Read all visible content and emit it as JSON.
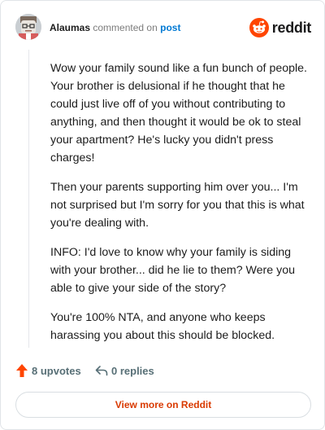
{
  "header": {
    "username": "Alaumas",
    "verb": "commented on",
    "target": "post",
    "brand": "reddit",
    "brand_color": "#ff4500"
  },
  "comment": {
    "paragraphs": [
      "Wow your family sound like a fun bunch of people. Your brother is delusional if he thought that he could just live off of you without contributing to anything, and then thought it would be ok to steal your apartment? He's lucky you didn't press charges!",
      "Then your parents supporting him over you... I'm not surprised but I'm sorry for you that this is what you're dealing with.",
      "INFO: I'd love to know why your family is siding with your brother... did he lie to them? Were you able to give your side of the story?",
      "You're 100% NTA, and anyone who keeps harassing you about this should be blocked."
    ]
  },
  "actions": {
    "upvotes": "8 upvotes",
    "replies": "0 replies",
    "upvote_icon": "upvote-arrow-icon",
    "reply_icon": "reply-arrow-icon"
  },
  "footer": {
    "view_more": "View more on Reddit"
  },
  "colors": {
    "accent": "#d93a00",
    "link": "#0079d3",
    "muted": "#576f76"
  }
}
